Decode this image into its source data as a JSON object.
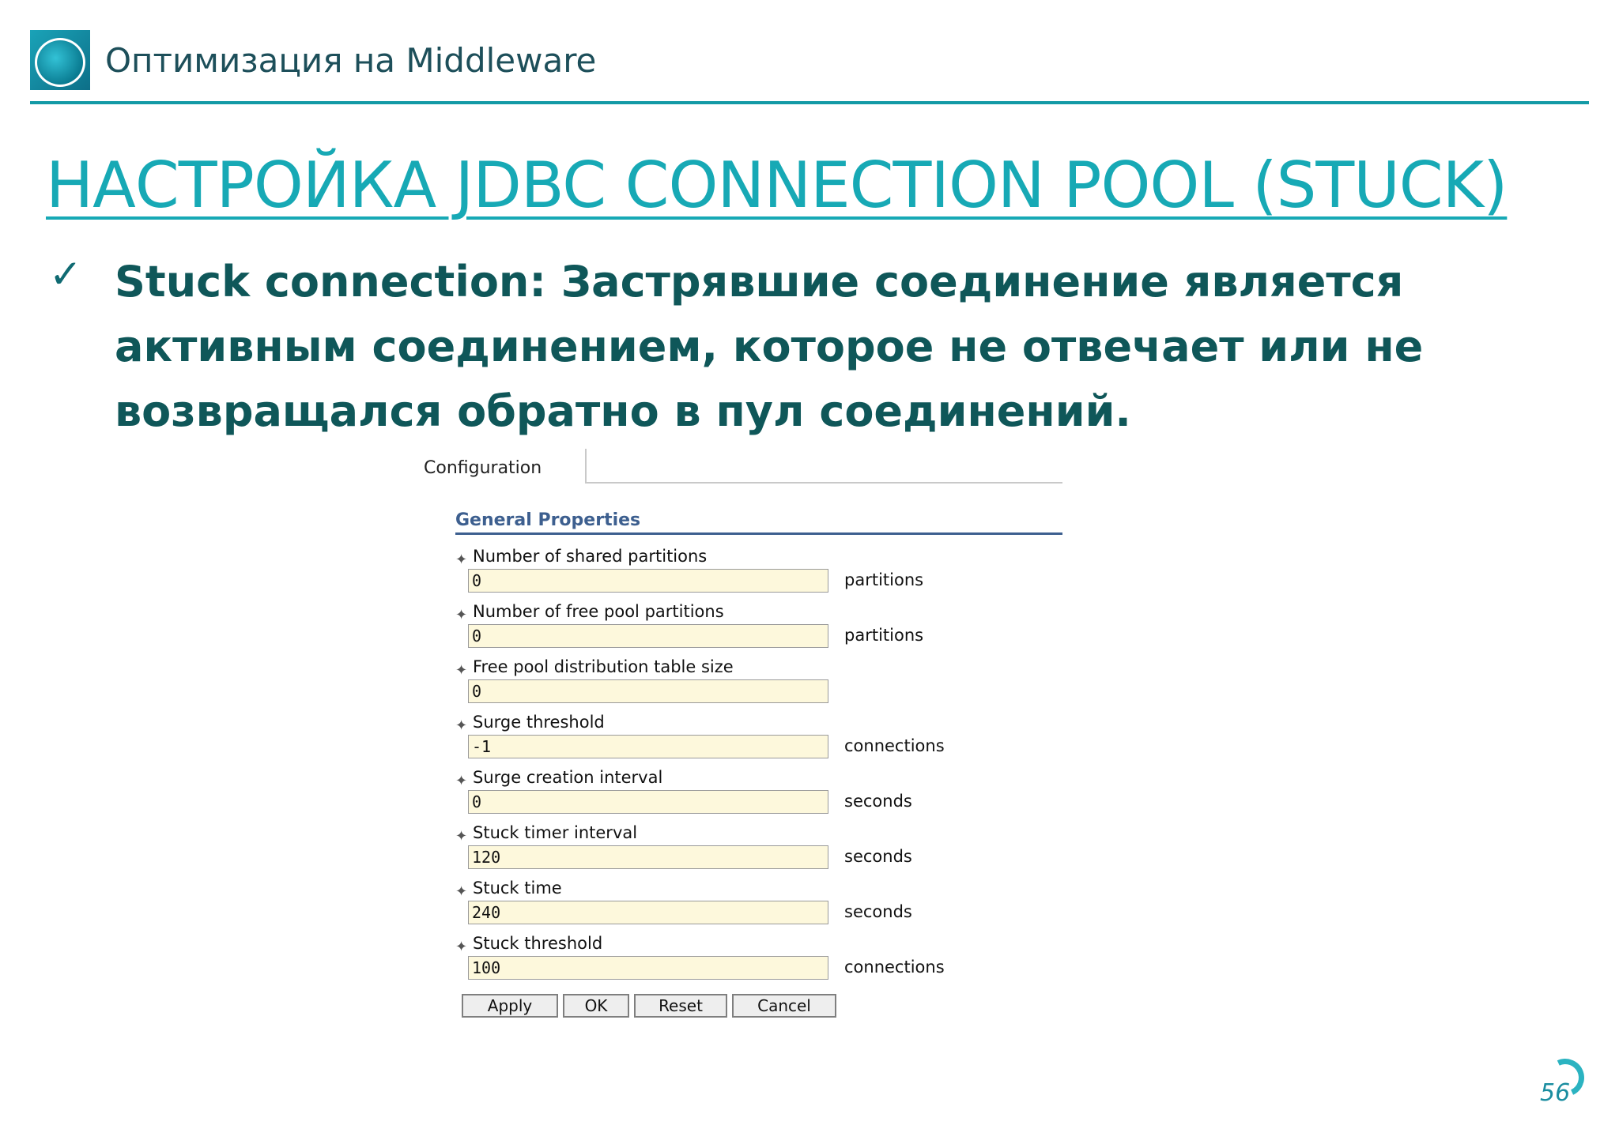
{
  "header": {
    "deck_title": "Оптимизация на Middleware"
  },
  "slide": {
    "title": "НАСТРОЙКА JDBC CONNECTION POOL (STUCK)",
    "bullet": "Stuck connection: Застрявшие соединение является активным соединением, которое не отвечает или не возвращался обратно в пул соединений.",
    "page_number": "56"
  },
  "console": {
    "tab_label": "Configuration",
    "section_title": "General Properties",
    "properties": [
      {
        "label": "Number of shared partitions",
        "value": "0",
        "unit": "partitions"
      },
      {
        "label": "Number of free pool partitions",
        "value": "0",
        "unit": "partitions"
      },
      {
        "label": "Free pool distribution table size",
        "value": "0",
        "unit": ""
      },
      {
        "label": "Surge threshold",
        "value": "-1",
        "unit": "connections"
      },
      {
        "label": "Surge creation interval",
        "value": "0",
        "unit": "seconds"
      },
      {
        "label": "Stuck timer interval",
        "value": "120",
        "unit": "seconds"
      },
      {
        "label": "Stuck time",
        "value": "240",
        "unit": "seconds"
      },
      {
        "label": "Stuck threshold",
        "value": "100",
        "unit": "connections"
      }
    ],
    "buttons": {
      "apply": "Apply",
      "ok": "OK",
      "reset": "Reset",
      "cancel": "Cancel"
    }
  },
  "colors": {
    "accent": "#17a9b5",
    "header_rule": "#139aa6",
    "bullet_text": "#0f5759",
    "field_bg": "#fdf8dc",
    "section_title": "#3d5f8f"
  }
}
